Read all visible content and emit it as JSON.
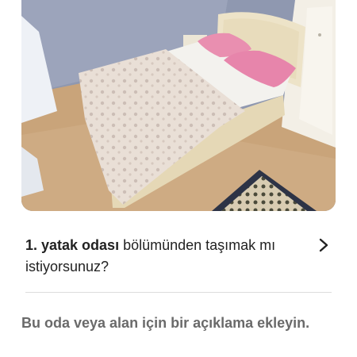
{
  "photo": {
    "icon": "bedroom-photo"
  },
  "move_prompt": {
    "room_name": "1. yatak odası",
    "rest": " bölümünden taşımak mı istiyorsunuz?",
    "icon": "chevron-right-icon"
  },
  "description_prompt": {
    "text": "Bu oda veya alan için bir açıklama ekleyin."
  },
  "colors": {
    "text_primary": "#222222",
    "text_secondary": "#6a6a6a",
    "divider": "#dddddd"
  }
}
